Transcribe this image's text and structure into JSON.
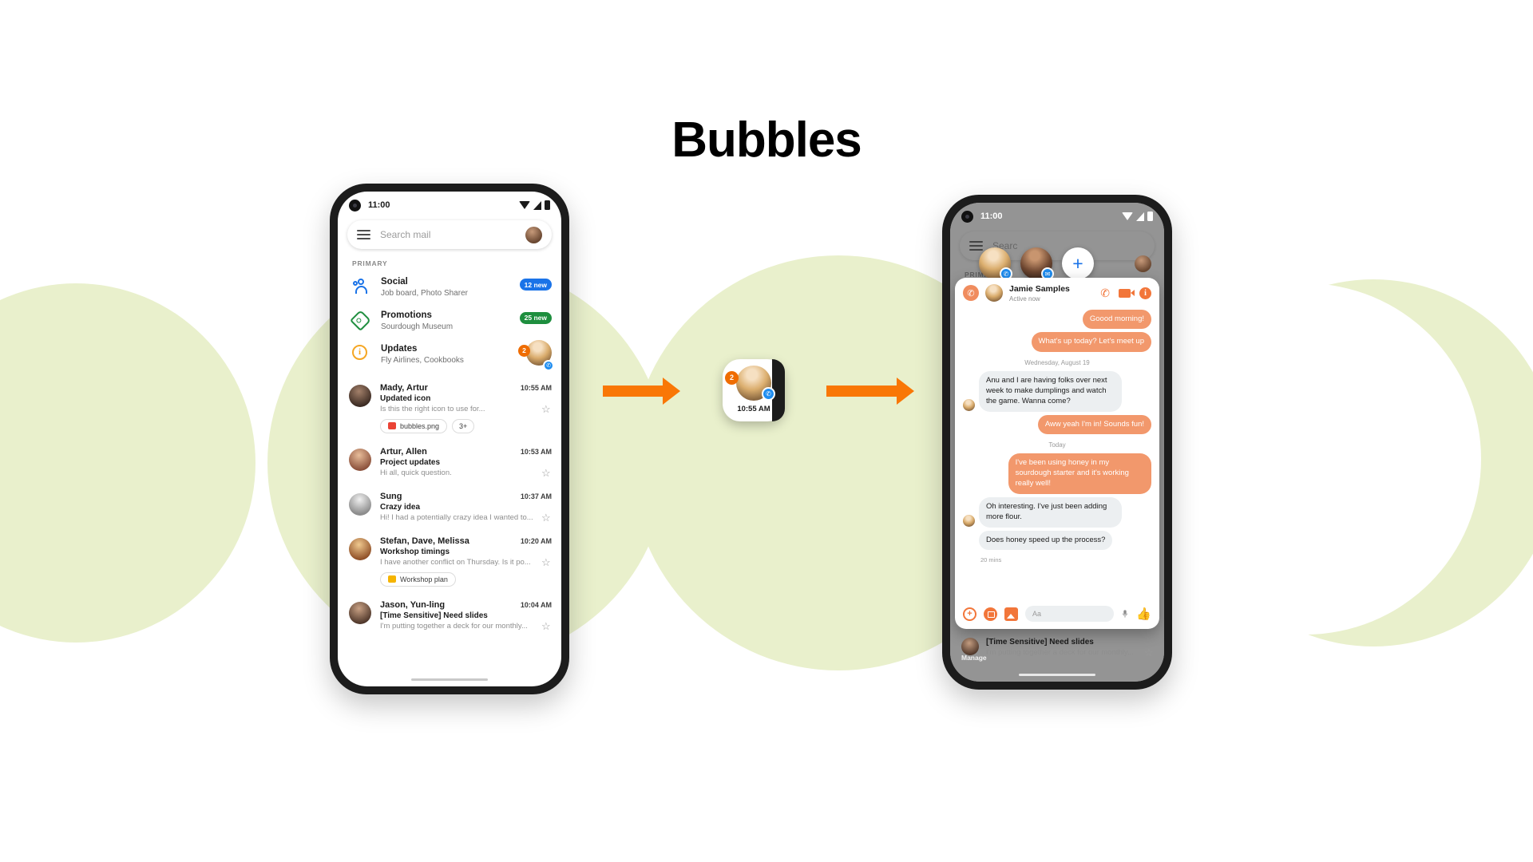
{
  "page": {
    "title": "Bubbles"
  },
  "colors": {
    "accent_orange": "#f97706",
    "bubble_orange": "#f2986c",
    "bg_circle": "#e9f0cc",
    "badge_blue": "#1a73e8",
    "badge_green": "#1e8e3e",
    "messenger_blue": "#1f8df0"
  },
  "left_phone": {
    "status": {
      "time": "11:00",
      "wifi_icon": "wifi-icon",
      "signal_icon": "signal-icon",
      "battery_icon": "battery-icon"
    },
    "search": {
      "placeholder": "Search mail",
      "menu_icon": "hamburger-menu-icon",
      "avatar": "account-avatar"
    },
    "section_label": "PRIMARY",
    "categories": [
      {
        "icon": "people-icon",
        "title": "Social",
        "subtitle": "Job board, Photo Sharer",
        "badge": "12 new",
        "badge_color": "blue"
      },
      {
        "icon": "tag-icon",
        "title": "Promotions",
        "subtitle": "Sourdough Museum",
        "badge": "25 new",
        "badge_color": "green"
      },
      {
        "icon": "info-icon",
        "title": "Updates",
        "subtitle": "Fly Airlines, Cookbooks",
        "bubble_count": "2",
        "bubble_icon": "messenger-icon"
      }
    ],
    "mails": [
      {
        "from": "Mady, Artur",
        "time": "10:55 AM",
        "subject": "Updated icon",
        "snippet": "Is this the right icon to use for...",
        "star_icon": "star-icon",
        "chips": [
          {
            "label": "bubbles.png",
            "icon": "image-file-icon",
            "color": "red"
          },
          {
            "label": "3+",
            "icon": "",
            "color": ""
          }
        ]
      },
      {
        "from": "Artur, Allen",
        "time": "10:53 AM",
        "subject": "Project updates",
        "snippet": "Hi all, quick question.",
        "star_icon": "star-icon",
        "chips": []
      },
      {
        "from": "Sung",
        "time": "10:37 AM",
        "subject": "Crazy idea",
        "snippet": "Hi! I had a potentially crazy idea I wanted to...",
        "star_icon": "star-icon",
        "chips": []
      },
      {
        "from": "Stefan, Dave, Melissa",
        "time": "10:20 AM",
        "subject": "Workshop timings",
        "snippet": "I have another conflict on Thursday. Is it po...",
        "star_icon": "star-icon",
        "chips": [
          {
            "label": "Workshop plan",
            "icon": "doc-file-icon",
            "color": "yellow"
          }
        ]
      },
      {
        "from": "Jason, Yun-ling",
        "time": "10:04 AM",
        "subject": "[Time Sensitive] Need slides",
        "snippet": "I'm putting together a deck for our monthly...",
        "star_icon": "star-icon",
        "chips": []
      }
    ]
  },
  "float_bubble": {
    "count": "2",
    "time": "10:55 AM",
    "app_icon": "messenger-icon",
    "avatar": "jamie-avatar"
  },
  "right_phone": {
    "status": {
      "time": "11:00"
    },
    "search": {
      "placeholder": "Searc"
    },
    "section_label": "PRIMARY",
    "bubbles": [
      {
        "name": "jamie-bubble",
        "app_icon": "messenger-icon"
      },
      {
        "name": "second-bubble",
        "app_icon": "messages-icon"
      }
    ],
    "add_label": "+",
    "chat": {
      "app_icon": "messenger-icon",
      "contact": "Jamie Samples",
      "status": "Active now",
      "actions": [
        "call-icon",
        "video-icon",
        "info-icon"
      ],
      "messages": [
        {
          "side": "out",
          "text": "Goood morning!"
        },
        {
          "side": "out",
          "text": "What's up today? Let's meet up"
        },
        {
          "sep": "Wednesday, August 19"
        },
        {
          "side": "in",
          "text": "Anu and I are having folks over next week to make dumplings and watch the game. Wanna come?",
          "avatar": true
        },
        {
          "side": "out",
          "text": "Aww yeah I'm in! Sounds fun!"
        },
        {
          "sep": "Today"
        },
        {
          "side": "out",
          "text": "I've been using honey in my sourdough starter and it's working really well!"
        },
        {
          "side": "in",
          "text": "Oh interesting. I've just been adding more flour.",
          "avatar": true
        },
        {
          "side": "in",
          "text": "Does honey speed up the process?"
        }
      ],
      "timestamp": "20 mins",
      "composer": {
        "placeholder": "Aa",
        "icons": [
          "plus-icon",
          "camera-icon",
          "gallery-icon",
          "mic-icon",
          "thumbs-up-icon"
        ]
      }
    },
    "manage_label": "Manage",
    "under_mail": {
      "subject": "[Time Sensitive] Need slides",
      "snippet": "I'm putting together a deck for our monthly...",
      "star_icon": "star-icon"
    }
  }
}
